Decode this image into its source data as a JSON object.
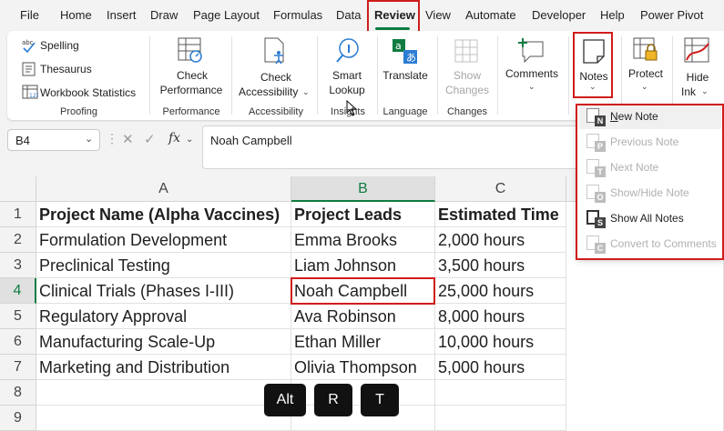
{
  "menu": {
    "tabs": [
      "File",
      "Home",
      "Insert",
      "Draw",
      "Page Layout",
      "Formulas",
      "Data",
      "Review",
      "View",
      "Automate",
      "Developer",
      "Help",
      "Power Pivot"
    ],
    "active": "Review"
  },
  "ribbon": {
    "proofing": {
      "spelling": "Spelling",
      "thesaurus": "Thesaurus",
      "workbook_statistics": "Workbook Statistics",
      "label": "Proofing"
    },
    "performance": {
      "check_performance_line1": "Check",
      "check_performance_line2": "Performance",
      "label": "Performance"
    },
    "accessibility": {
      "check_line1": "Check",
      "check_line2": "Accessibility",
      "label": "Accessibility"
    },
    "insights": {
      "smart_line1": "Smart",
      "smart_line2": "Lookup",
      "label": "Insights"
    },
    "language": {
      "translate": "Translate",
      "label": "Language"
    },
    "changes": {
      "show_line1": "Show",
      "show_line2": "Changes",
      "label": "Changes"
    },
    "comments": {
      "label": "Comments"
    },
    "notes": {
      "label": "Notes"
    },
    "protect": {
      "label": "Protect"
    },
    "ink": {
      "line1": "Hide",
      "line2": "Ink"
    }
  },
  "formula_bar": {
    "name_box": "B4",
    "fx": "fx",
    "value": "Noah Campbell"
  },
  "sheet": {
    "columns": [
      "A",
      "B",
      "C"
    ],
    "rows": [
      "1",
      "2",
      "3",
      "4",
      "5",
      "6",
      "7",
      "8",
      "9"
    ],
    "header": [
      "Project Name (Alpha Vaccines)",
      "Project Leads",
      "Estimated Time"
    ],
    "data": [
      [
        "Formulation Development",
        "Emma Brooks",
        "2,000 hours"
      ],
      [
        "Preclinical Testing",
        "Liam Johnson",
        "3,500 hours"
      ],
      [
        "Clinical Trials (Phases I-III)",
        "Noah Campbell",
        "25,000 hours"
      ],
      [
        "Regulatory Approval",
        "Ava Robinson",
        "8,000 hours"
      ],
      [
        "Manufacturing Scale-Up",
        "Ethan Miller",
        "10,000 hours"
      ],
      [
        "Marketing and Distribution",
        "Olivia Thompson",
        "5,000 hours"
      ]
    ]
  },
  "notes_menu": {
    "items": [
      {
        "label": "New Note",
        "letter": "N"
      },
      {
        "label": "Previous Note",
        "letter": "P"
      },
      {
        "label": "Next Note",
        "letter": "T"
      },
      {
        "label": "Show/Hide Note",
        "letter": "O"
      },
      {
        "label": "Show All Notes",
        "letter": "S"
      },
      {
        "label": "Convert to Comments",
        "letter": "C"
      }
    ]
  },
  "keys": [
    "Alt",
    "R",
    "T"
  ],
  "colors": {
    "accent": "#107c41",
    "highlight": "#d01c1c"
  }
}
